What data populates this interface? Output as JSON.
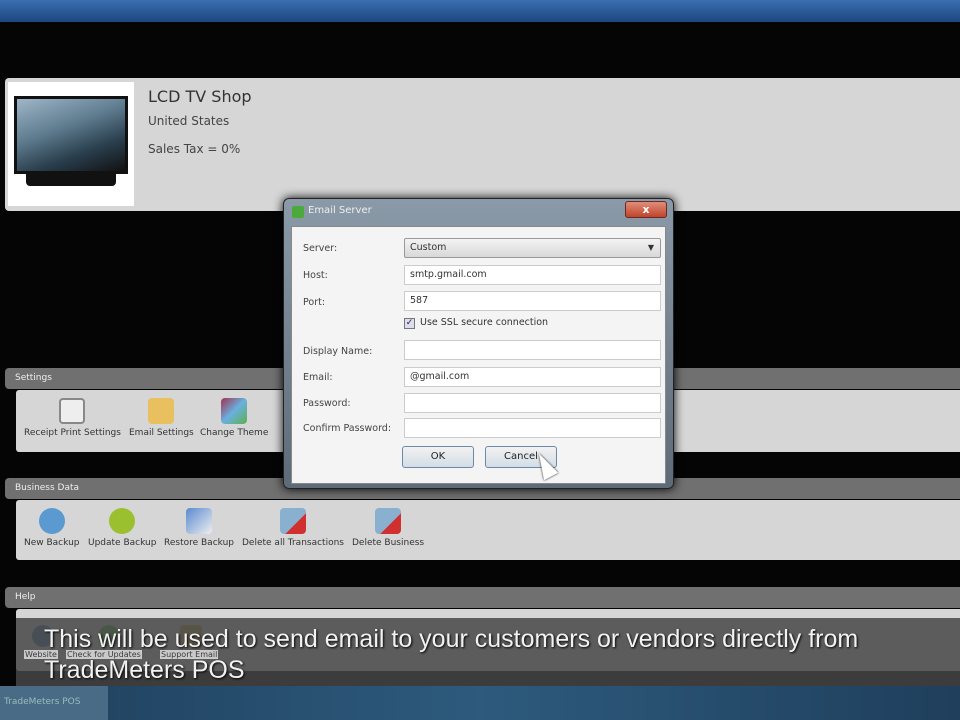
{
  "shop": {
    "name": "LCD TV Shop",
    "country": "United States",
    "tax": "Sales Tax = 0%"
  },
  "settings": {
    "title": "Settings",
    "items": [
      {
        "label": "Receipt Print Settings",
        "icon": "printer-icon"
      },
      {
        "label": "Email Settings",
        "icon": "email-settings-icon"
      },
      {
        "label": "Change Theme",
        "icon": "theme-icon"
      }
    ]
  },
  "business": {
    "title": "Business Data",
    "items": [
      {
        "label": "New Backup",
        "icon": "backup-icon"
      },
      {
        "label": "Update Backup",
        "icon": "update-icon"
      },
      {
        "label": "Restore Backup",
        "icon": "restore-icon"
      },
      {
        "label": "Delete all Transactions",
        "icon": "delete-transactions-icon"
      },
      {
        "label": "Delete Business",
        "icon": "delete-business-icon"
      }
    ]
  },
  "help": {
    "title": "Help",
    "items": [
      {
        "label": "Website"
      },
      {
        "label": "Check for Updates"
      },
      {
        "label": "Support Email"
      }
    ]
  },
  "dialog": {
    "title": "Email Server",
    "close": "x",
    "server_label": "Server:",
    "server_value": "Custom",
    "host_label": "Host:",
    "host_value": "smtp.gmail.com",
    "port_label": "Port:",
    "port_value": "587",
    "ssl_label": "Use SSL secure connection",
    "ssl_checked": true,
    "display_label": "Display Name:",
    "display_value": "",
    "email_label": "Email:",
    "email_value": "@gmail.com",
    "password_label": "Password:",
    "password_value": "",
    "confirm_label": "Confirm Password:",
    "confirm_value": "",
    "ok": "OK",
    "cancel": "Cancel"
  },
  "caption": "This will be used to send email to your customers or vendors directly from TradeMeters POS",
  "taskbar": {
    "app": "TradeMeters POS"
  }
}
